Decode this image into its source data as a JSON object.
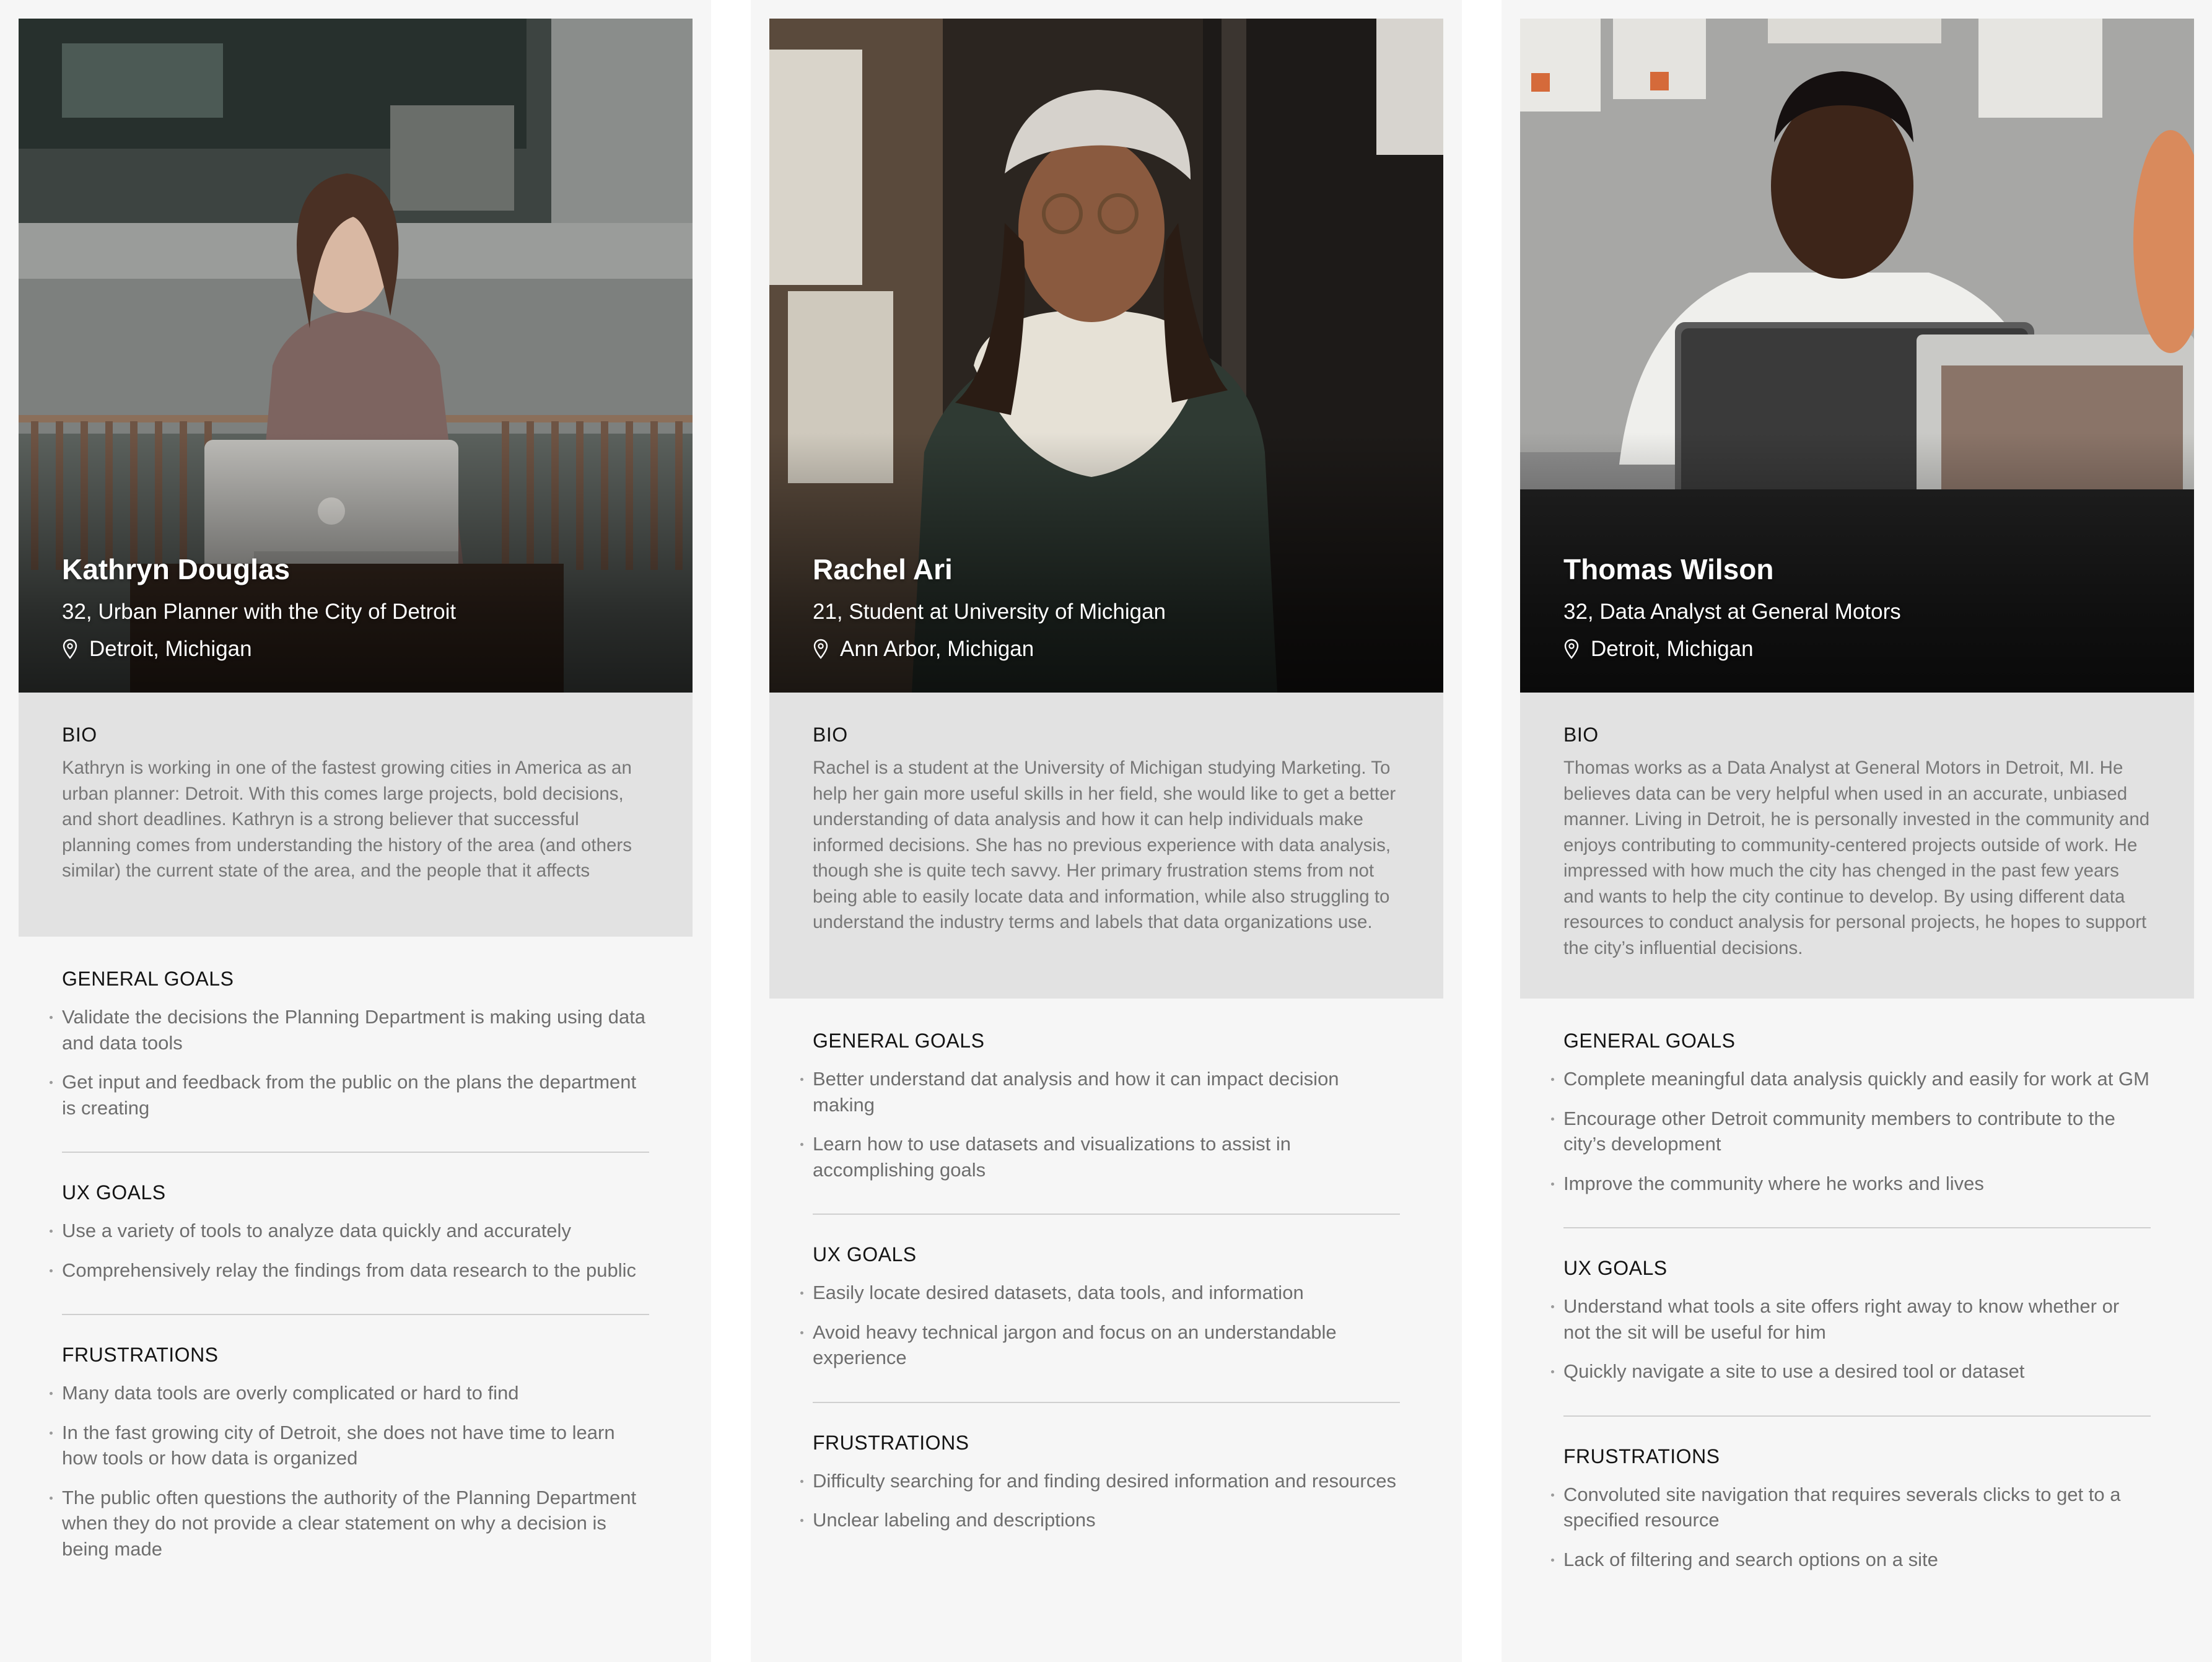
{
  "personas": [
    {
      "name": "Kathryn Douglas",
      "role": "32, Urban Planner with the City of Detroit",
      "location": "Detroit, Michigan",
      "bio_title": "BIO",
      "bio": "Kathryn is working in one of the fastest growing cities in America as an urban planner: Detroit. With this comes large projects, bold decisions, and short deadlines. Kathryn is a strong believer that successful planning comes from understanding the history of the area (and others similar) the current state of the area, and the people that it affects",
      "general_goals_title": "GENERAL GOALS",
      "general_goals": [
        "Validate the decisions the Planning Department is making using data and data tools",
        "Get input and feedback from the public on the plans the department is creating"
      ],
      "ux_goals_title": "UX GOALS",
      "ux_goals": [
        "Use a variety of tools to analyze data quickly and accurately",
        "Comprehensively relay the findings from data research to the public"
      ],
      "frustrations_title": "FRUSTRATIONS",
      "frustrations": [
        "Many data tools are overly complicated or hard to find",
        "In the fast growing city of Detroit, she does not have time to learn how tools or how data is organized",
        "The public often questions the authority of the Planning Department when they do not provide a clear statement on why a decision is being made"
      ]
    },
    {
      "name": "Rachel Ari",
      "role": "21, Student at University of Michigan",
      "location": "Ann Arbor, Michigan",
      "bio_title": "BIO",
      "bio": "Rachel is a student at the University of Michigan studying Marketing. To help her gain more useful skills in her field, she would like to get a better understanding of data analysis and how it can help individuals make informed decisions. She has no previous experience with data analysis, though she is quite tech savvy. Her primary frustration stems from not being able to easily locate data and information, while also struggling to understand the industry terms and labels that data organizations use.",
      "general_goals_title": "GENERAL GOALS",
      "general_goals": [
        "Better understand dat analysis and how it can impact decision making",
        "Learn how to use datasets and visualizations to assist in accomplishing goals"
      ],
      "ux_goals_title": "UX GOALS",
      "ux_goals": [
        "Easily locate desired datasets, data tools, and information",
        "Avoid heavy technical jargon and focus on an understandable experience"
      ],
      "frustrations_title": "FRUSTRATIONS",
      "frustrations": [
        "Difficulty searching for and finding desired information and resources",
        "Unclear labeling and descriptions"
      ]
    },
    {
      "name": "Thomas Wilson",
      "role": "32, Data Analyst at General Motors",
      "location": "Detroit, Michigan",
      "bio_title": "BIO",
      "bio": "Thomas works as a Data Analyst at General Motors in Detroit, MI. He believes data can be very helpful when used in an accurate, unbiased manner. Living in Detroit, he is personally invested in the community and enjoys contributing to community-centered projects outside of work. He impressed with how much the city has chenged in the past few years and wants to help the city continue to develop. By using different data resources to conduct analysis for personal projects, he hopes to support the city’s influential decisions.",
      "general_goals_title": "GENERAL GOALS",
      "general_goals": [
        "Complete meaningful data analysis quickly and easily for work at GM",
        "Encourage other Detroit community members to contribute to the city’s development",
        "Improve the community where he works and lives"
      ],
      "ux_goals_title": "UX GOALS",
      "ux_goals": [
        "Understand what tools a site offers right away to know whether or not the sit will be useful for him",
        "Quickly navigate a site to use a desired tool or dataset"
      ],
      "frustrations_title": "FRUSTRATIONS",
      "frustrations": [
        "Convoluted site navigation that requires severals clicks to get to a specified resource",
        "Lack of filtering and search options on a site"
      ]
    }
  ],
  "icons": {
    "location": "map-pin-icon"
  },
  "colors": {
    "column_bg": "#f6f6f6",
    "bio_bg": "#e2e2e2",
    "title_text": "#141414",
    "body_text": "#6e6e6e",
    "divider": "#cfcfcf"
  }
}
